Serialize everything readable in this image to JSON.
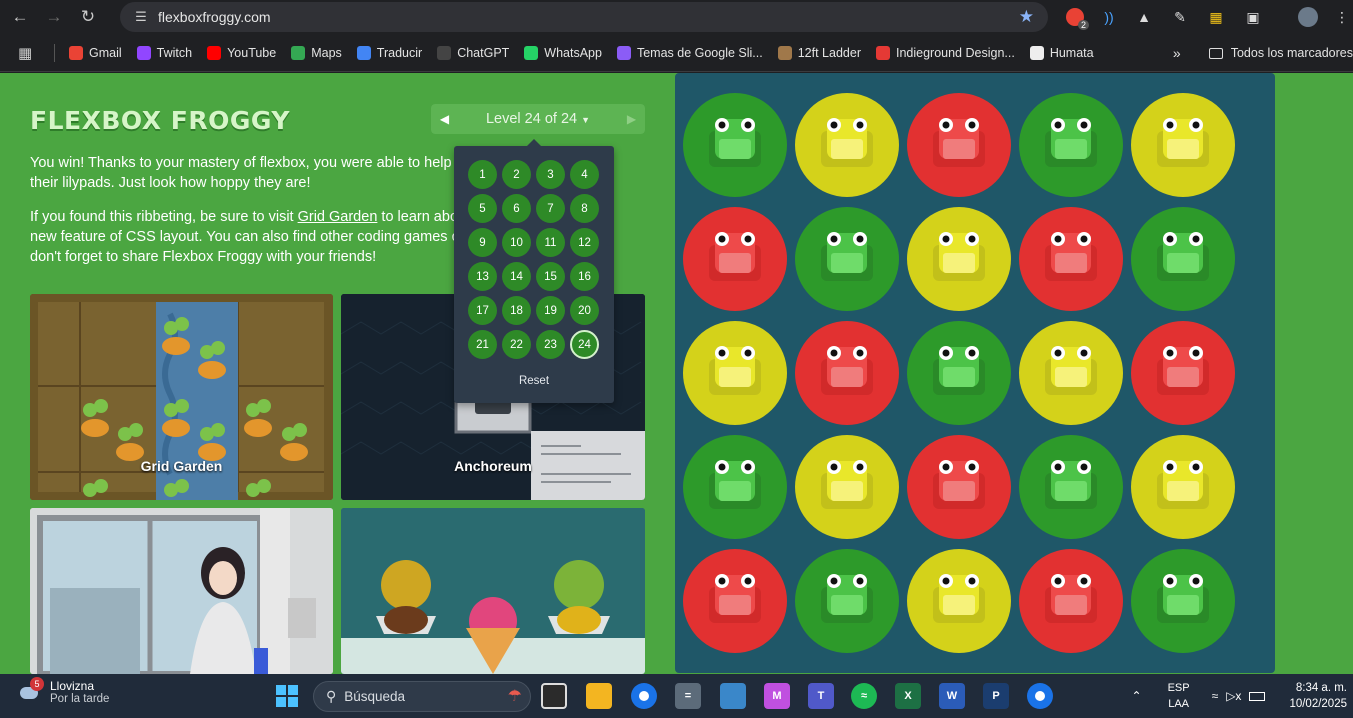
{
  "browser": {
    "url": "flexboxfroggy.com",
    "extension_badge": "2",
    "bookmarks": [
      {
        "label": "Gmail",
        "color": "#ea4335"
      },
      {
        "label": "Twitch",
        "color": "#9146ff"
      },
      {
        "label": "YouTube",
        "color": "#ff0000"
      },
      {
        "label": "Maps",
        "color": "#34a853"
      },
      {
        "label": "Traducir",
        "color": "#4285f4"
      },
      {
        "label": "ChatGPT",
        "color": "#444444"
      },
      {
        "label": "WhatsApp",
        "color": "#25d366"
      },
      {
        "label": "Temas de Google Sli...",
        "color": "#8b5cf6"
      },
      {
        "label": "12ft Ladder",
        "color": "#a0784a"
      },
      {
        "label": "Indieground Design...",
        "color": "#e53935"
      },
      {
        "label": "Humata",
        "color": "#eeeeee"
      }
    ],
    "all_bookmarks": "Todos los marcadores"
  },
  "page": {
    "logo": "FLEXBOX FROGGY",
    "level_label": "Level 24 of 24",
    "win_text": "You win! Thanks to your mastery of flexbox, you were able to help all of the frogs to their lilypads. Just look how hoppy they are!",
    "visit_prefix": "If you found this ribbeting, be sure to visit ",
    "grid_garden_link": "Grid Garden",
    "visit_suffix": " to learn about another powerful new feature of CSS layout. You can also find other coding games over at Codepip. And don't forget to share Flexbox Froggy with your friends!",
    "cards": [
      {
        "label": "Grid Garden"
      },
      {
        "label": "Anchoreum"
      },
      {
        "label": ""
      },
      {
        "label": ""
      }
    ],
    "levels": [
      "1",
      "2",
      "3",
      "4",
      "5",
      "6",
      "7",
      "8",
      "9",
      "10",
      "11",
      "12",
      "13",
      "14",
      "15",
      "16",
      "17",
      "18",
      "19",
      "20",
      "21",
      "22",
      "23",
      "24"
    ],
    "current_level": "24",
    "reset_label": "Reset"
  },
  "board": {
    "colors": {
      "green": "#2d9a2a",
      "yellow": "#d4d21a",
      "red": "#e23131"
    },
    "grid": [
      [
        "green",
        "yellow",
        "red",
        "green",
        "yellow"
      ],
      [
        "red",
        "green",
        "yellow",
        "red",
        "green"
      ],
      [
        "yellow",
        "red",
        "green",
        "yellow",
        "red"
      ],
      [
        "green",
        "yellow",
        "red",
        "green",
        "yellow"
      ],
      [
        "red",
        "green",
        "yellow",
        "red",
        "green"
      ]
    ]
  },
  "taskbar": {
    "weather_badge": "5",
    "weather_title": "Llovizna",
    "weather_subtitle": "Por la tarde",
    "search_placeholder": "Búsqueda",
    "lang1": "ESP",
    "lang2": "LAA",
    "time": "8:34 a. m.",
    "date": "10/02/2025"
  }
}
